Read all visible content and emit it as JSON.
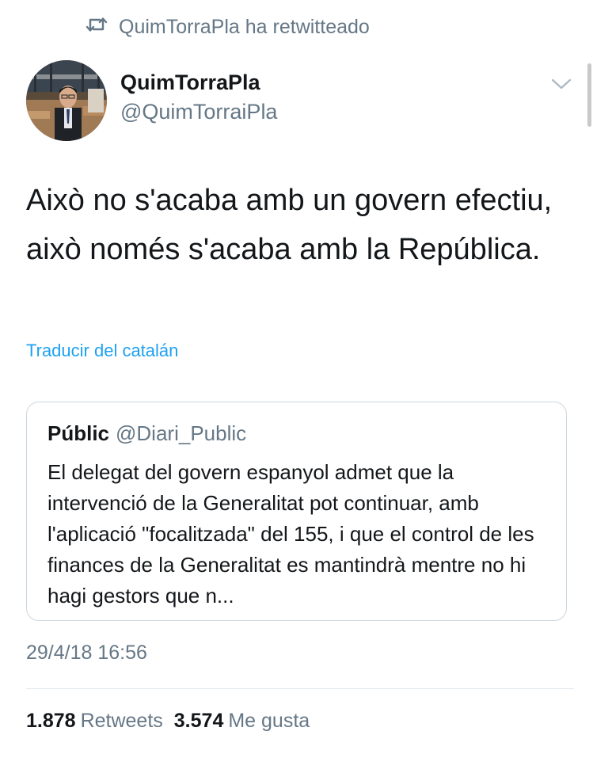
{
  "retweet_banner": {
    "icon": "retweet-icon",
    "text": "QuimTorraPla ha retwitteado"
  },
  "author": {
    "display_name": "QuimTorraPla",
    "handle": "@QuimTorraiPla"
  },
  "tweet": {
    "text": "Això no s'acaba amb un govern efectiu, això només s'acaba amb la República.",
    "translate_link": "Traducir del catalán"
  },
  "quoted_tweet": {
    "name": "Públic",
    "handle": "@Diari_Public",
    "text": "El delegat del govern espanyol admet que la intervenció de la Generalitat pot continuar, amb l'aplicació \"focalitzada\" del 155, i que el control de les finances de la Generalitat es mantindrà mentre no hi hagi gestors que n..."
  },
  "timestamp": "29/4/18 16:56",
  "stats": {
    "retweets_count": "1.878",
    "retweets_label": "Retweets",
    "likes_count": "3.574",
    "likes_label": "Me gusta"
  },
  "colors": {
    "text": "#14171a",
    "secondary": "#657786",
    "link": "#1da1f2",
    "border": "#ccd6dd"
  }
}
